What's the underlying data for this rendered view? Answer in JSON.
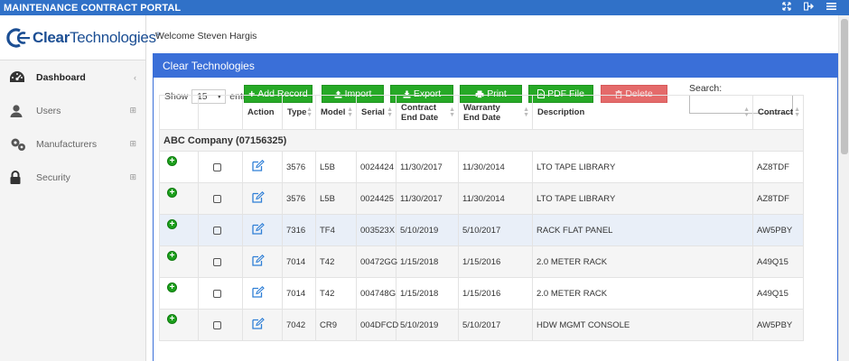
{
  "topbar": {
    "title": "MAINTENANCE CONTRACT PORTAL",
    "icons": [
      "expand-icon",
      "logout-icon",
      "menu-icon"
    ]
  },
  "logo": {
    "brand_bold": "Clear",
    "brand_rest": "Technologies",
    "registered": "®"
  },
  "sidebar": {
    "items": [
      {
        "label": "Dashboard",
        "icon": "dashboard-icon",
        "active": true,
        "expander": "‹"
      },
      {
        "label": "Users",
        "icon": "user-icon",
        "active": false,
        "expander": "⊞"
      },
      {
        "label": "Manufacturers",
        "icon": "manufacturers-icon",
        "active": false,
        "expander": "⊞"
      },
      {
        "label": "Security",
        "icon": "lock-icon",
        "active": false,
        "expander": "⊞"
      }
    ]
  },
  "welcome": "Welcome Steven Hargis",
  "panel": {
    "title": "Clear Technologies"
  },
  "controls": {
    "show_label": "Show",
    "entries_value": "15",
    "entries_label": "entries",
    "search_label": "Search:",
    "buttons": {
      "add": "Add Record",
      "import": "Import",
      "export": "Export",
      "print": "Print",
      "pdf": "PDF File",
      "delete": "Delete"
    }
  },
  "table": {
    "headers": {
      "action": "Action",
      "type": "Type",
      "model": "Model",
      "serial": "Serial",
      "contract_end_1": "Contract",
      "contract_end_2": "End Date",
      "warranty_end_1": "Warranty",
      "warranty_end_2": "End Date",
      "description": "Description",
      "contract": "Contract"
    },
    "group": "ABC Company (07156325)",
    "rows": [
      {
        "type": "3576",
        "model": "L5B",
        "serial": "0024424",
        "contract_end": "11/30/2017",
        "warranty_end": "11/30/2014",
        "description": "LTO TAPE LIBRARY",
        "contract": "AZ8TDF"
      },
      {
        "type": "3576",
        "model": "L5B",
        "serial": "0024425",
        "contract_end": "11/30/2017",
        "warranty_end": "11/30/2014",
        "description": "LTO TAPE LIBRARY",
        "contract": "AZ8TDF"
      },
      {
        "type": "7316",
        "model": "TF4",
        "serial": "003523X",
        "contract_end": "5/10/2019",
        "warranty_end": "5/10/2017",
        "description": "RACK FLAT PANEL",
        "contract": "AW5PBY"
      },
      {
        "type": "7014",
        "model": "T42",
        "serial": "00472GG",
        "contract_end": "1/15/2018",
        "warranty_end": "1/15/2016",
        "description": "2.0 METER RACK",
        "contract": "A49Q15"
      },
      {
        "type": "7014",
        "model": "T42",
        "serial": "004748G",
        "contract_end": "1/15/2018",
        "warranty_end": "1/15/2016",
        "description": "2.0 METER RACK",
        "contract": "A49Q15"
      },
      {
        "type": "7042",
        "model": "CR9",
        "serial": "004DFCD",
        "contract_end": "5/10/2019",
        "warranty_end": "5/10/2017",
        "description": "HDW MGMT CONSOLE",
        "contract": "AW5PBY"
      }
    ]
  },
  "colors": {
    "brand_blue": "#3a6fd8",
    "button_green": "#26a926",
    "delete_red": "#e46a6a"
  }
}
